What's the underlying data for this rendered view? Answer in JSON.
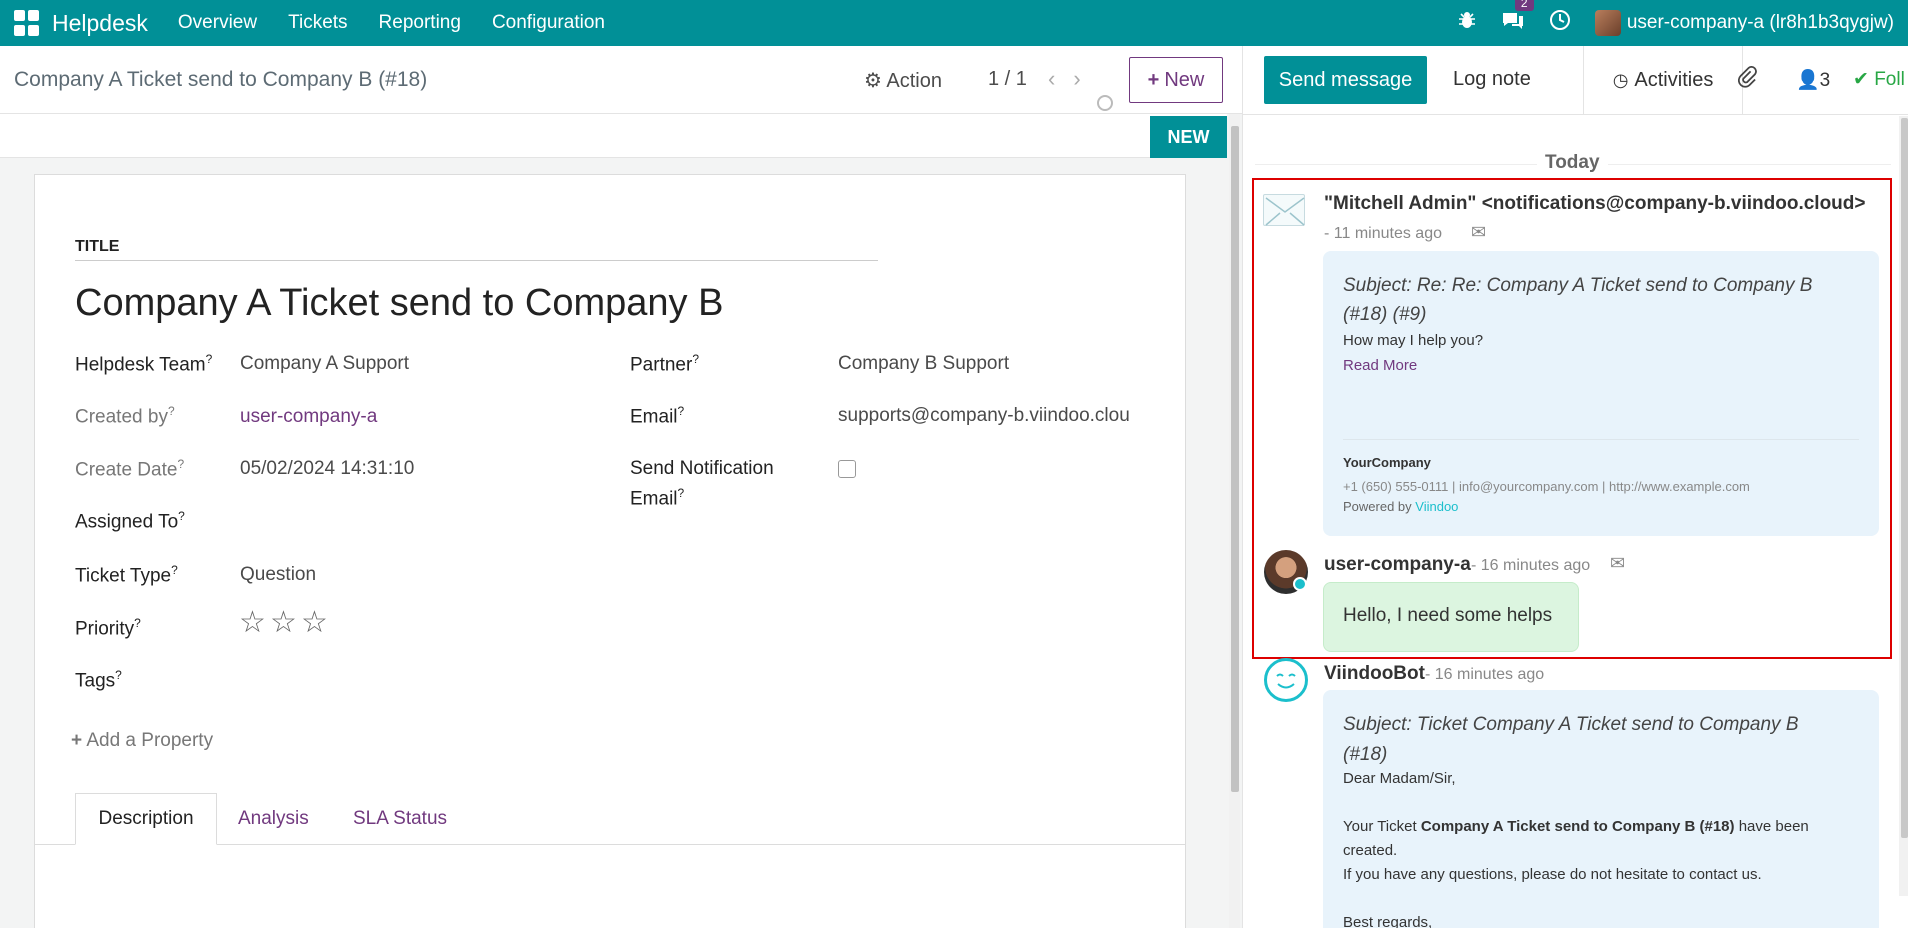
{
  "navbar": {
    "brand": "Helpdesk",
    "menu": [
      "Overview",
      "Tickets",
      "Reporting",
      "Configuration"
    ],
    "messages_count": "2",
    "user": "user-company-a (lr8h1b3qygjw)"
  },
  "control": {
    "breadcrumb": "Company A Ticket send to Company B (#18)",
    "action": "Action",
    "pager": "1 / 1",
    "new_button": "New"
  },
  "form": {
    "stage": "NEW",
    "title_label": "TITLE",
    "title": "Company A Ticket send to Company B",
    "fields": {
      "helpdesk_team": {
        "label": "Helpdesk Team",
        "value": "Company A Support"
      },
      "created_by": {
        "label": "Created by",
        "value": "user-company-a"
      },
      "create_date": {
        "label": "Create Date",
        "value": "05/02/2024 14:31:10"
      },
      "assigned_to": {
        "label": "Assigned To",
        "value": ""
      },
      "ticket_type": {
        "label": "Ticket Type",
        "value": "Question"
      },
      "priority": {
        "label": "Priority",
        "stars": 0,
        "max": 3
      },
      "tags": {
        "label": "Tags"
      },
      "partner": {
        "label": "Partner",
        "value": "Company B Support"
      },
      "email": {
        "label": "Email",
        "value": "supports@company-b.viindoo.clou"
      },
      "send_notification_line1": "Send Notification",
      "send_notification_line2": "Email",
      "send_notification_checked": false
    },
    "add_property": "Add a Property",
    "tabs": [
      "Description",
      "Analysis",
      "SLA Status"
    ]
  },
  "chatter": {
    "send_message": "Send message",
    "log_note": "Log note",
    "activities": "Activities",
    "followers_count": "3",
    "follow": "Foll",
    "date_separator": "Today",
    "messages": [
      {
        "author": "\"Mitchell Admin\" <notifications@company-b.viindoo.cloud>",
        "time": "- 11 minutes ago",
        "subject_line1": "Subject: Re: Re: Company A Ticket send to Company B",
        "subject_line2": "(#18) (#9)",
        "body": "How may I help you?",
        "read_more": "Read More",
        "company": "YourCompany",
        "contact": "+1 (650) 555-0111 | info@yourcompany.com | http://www.example.com",
        "powered_by": "Powered by",
        "powered_link": "Viindoo"
      },
      {
        "author": "user-company-a",
        "time": "- 16 minutes ago",
        "body": "Hello, I need some helps"
      },
      {
        "author": "ViindooBot",
        "time": "- 16 minutes ago",
        "subject_line1": "Subject: Ticket Company A Ticket send to Company B",
        "subject_line2": "(#18)",
        "greeting": "Dear Madam/Sir,",
        "body_prefix": "Your Ticket",
        "body_bold": "Company A Ticket send to Company B (#18)",
        "body_suffix": "have been",
        "body_line2": "created.",
        "body_line3": "If you have any questions, please do not hesitate to contact us.",
        "closing": "Best regards,"
      }
    ]
  }
}
